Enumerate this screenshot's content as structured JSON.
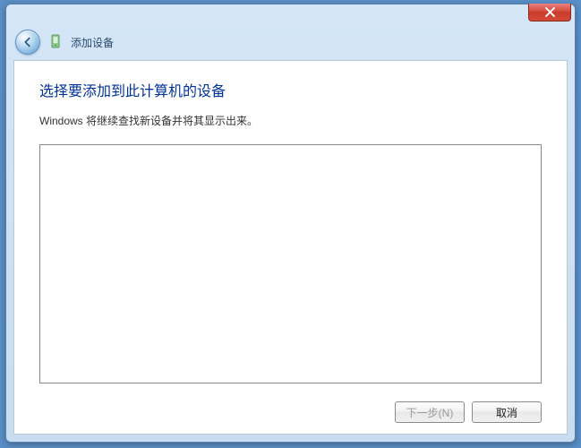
{
  "header": {
    "title": "添加设备"
  },
  "content": {
    "heading": "选择要添加到此计算机的设备",
    "subtext": "Windows 将继续查找新设备并将其显示出来。"
  },
  "footer": {
    "next_label": "下一步(N)",
    "cancel_label": "取消"
  }
}
